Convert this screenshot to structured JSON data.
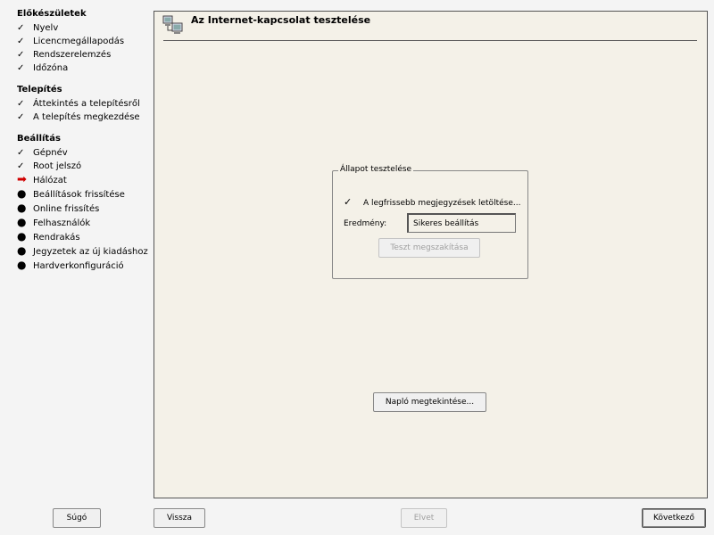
{
  "sidebar": {
    "sections": [
      {
        "title": "Előkészületek",
        "items": [
          {
            "label": "Nyelv",
            "state": "done"
          },
          {
            "label": "Licencmegállapodás",
            "state": "done"
          },
          {
            "label": "Rendszerelemzés",
            "state": "done"
          },
          {
            "label": "Időzóna",
            "state": "done"
          }
        ]
      },
      {
        "title": "Telepítés",
        "items": [
          {
            "label": "Áttekintés a telepítésről",
            "state": "done"
          },
          {
            "label": "A telepítés megkezdése",
            "state": "done"
          }
        ]
      },
      {
        "title": "Beállítás",
        "items": [
          {
            "label": "Gépnév",
            "state": "done"
          },
          {
            "label": "Root jelszó",
            "state": "done"
          },
          {
            "label": "Hálózat",
            "state": "current"
          },
          {
            "label": "Beállítások frissítése",
            "state": "pending"
          },
          {
            "label": "Online frissítés",
            "state": "pending"
          },
          {
            "label": "Felhasználók",
            "state": "pending"
          },
          {
            "label": "Rendrakás",
            "state": "pending"
          },
          {
            "label": "Jegyzetek az új kiadáshoz",
            "state": "pending"
          },
          {
            "label": "Hardverkonfiguráció",
            "state": "pending"
          }
        ]
      }
    ],
    "icons": {
      "done": "checkmark-icon",
      "current": "red-arrow-icon",
      "pending": "bullet-icon"
    },
    "colors": {
      "current_arrow": "#d00000"
    }
  },
  "main": {
    "title": "Az Internet-kapcsolat tesztelése",
    "title_icon": "network-computers-icon",
    "status_group": {
      "legend": "Állapot tesztelése",
      "status_text": "A legfrissebb megjegyzések letöltése...",
      "result_label": "Eredmény:",
      "result_value": "Sikeres beállítás",
      "stop_button": "Teszt megszakítása"
    },
    "view_log_button": "Napló megtekintése..."
  },
  "footer": {
    "help": "Súgó",
    "back": "Vissza",
    "abort": "Elvet",
    "next": "Következő"
  }
}
